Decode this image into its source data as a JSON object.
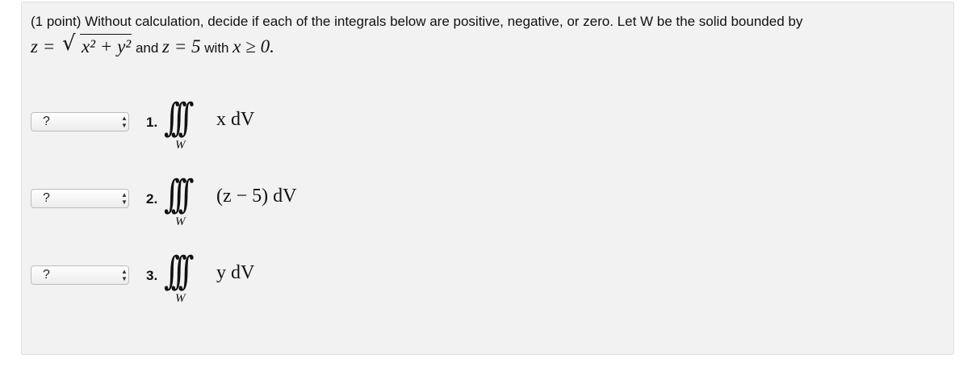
{
  "problem": {
    "intro": "(1 point) Without calculation, decide if each of the integrals below are positive, negative, or zero. Let W be the solid bounded by",
    "region": {
      "eq1_lhs": "z =",
      "eq1_rad": "x² + y²",
      "and": "and",
      "eq2": "z = 5",
      "with": "with",
      "cond": "x ≥ 0."
    }
  },
  "items": [
    {
      "select_value": "?",
      "number": "1.",
      "integrand": "x dV",
      "domain": "W"
    },
    {
      "select_value": "?",
      "number": "2.",
      "integrand": "(z − 5) dV",
      "domain": "W"
    },
    {
      "select_value": "?",
      "number": "3.",
      "integrand": "y dV",
      "domain": "W"
    }
  ]
}
